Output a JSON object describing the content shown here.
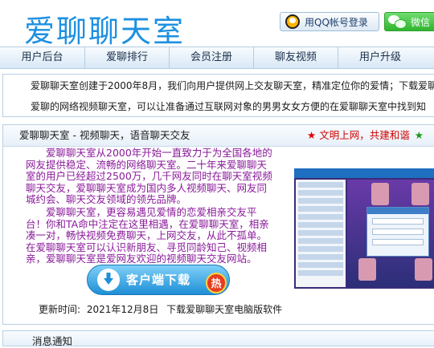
{
  "header": {
    "logo": "爱聊聊天室",
    "qq_login": "用QQ帐号登录",
    "wechat_login": "微信"
  },
  "nav": [
    "用户后台",
    "爱聊排行",
    "会员注册",
    "聊友视频",
    "用户升级"
  ],
  "notice": {
    "line1": "爱聊聊天室创建于2000年8月，我们向用户提供网上交友聊天室，精准定位你的爱情；下载爱聊",
    "line2": "爱聊的网络视频聊天室，可以让准备通过互联网对象的男男女女方便的在爱聊聊天室中找到知"
  },
  "panel": {
    "title": "爱聊聊天室 - 视频聊天，语音聊天交友",
    "slogan": "文明上网，共建和谐",
    "intro1": "爱聊聊天室从2000年开始一直致力于为全国各地的网友提供稳定、流畅的网络聊天室。二十年来爱聊聊天室的用户已经超过2500万，几千网友同时在聊天室视频聊天交友，爱聊聊天室成为国内多人视频聊天、网友同城约会、聊天交友领域的领先品牌。",
    "intro2": "爱聊聊天室，更容易遇见爱情的恋爱相亲交友平台！你和TA命中注定在这里相遇，在爱聊聊天室，相亲凑一对，畅快视频免费聊天，上网交友，从此不孤单。在爱聊聊天室可以认识新朋友、寻觅同龄知己、视频相亲，爱聊聊天室是爱网友欢迎的视频聊天交友网站。",
    "download_button": "客户端下载",
    "hot_badge": "热",
    "update_label": "更新时间:",
    "update_date": "2021年12月8日",
    "update_link": "下载爱聊聊天室电脑版软件"
  },
  "panel2": {
    "title": "消息通知"
  },
  "colors": {
    "logo": "#1e90e0",
    "intro_text": "#8a1a9a",
    "slogan": "#d00000",
    "nav_bg": "#d9e8f6"
  }
}
